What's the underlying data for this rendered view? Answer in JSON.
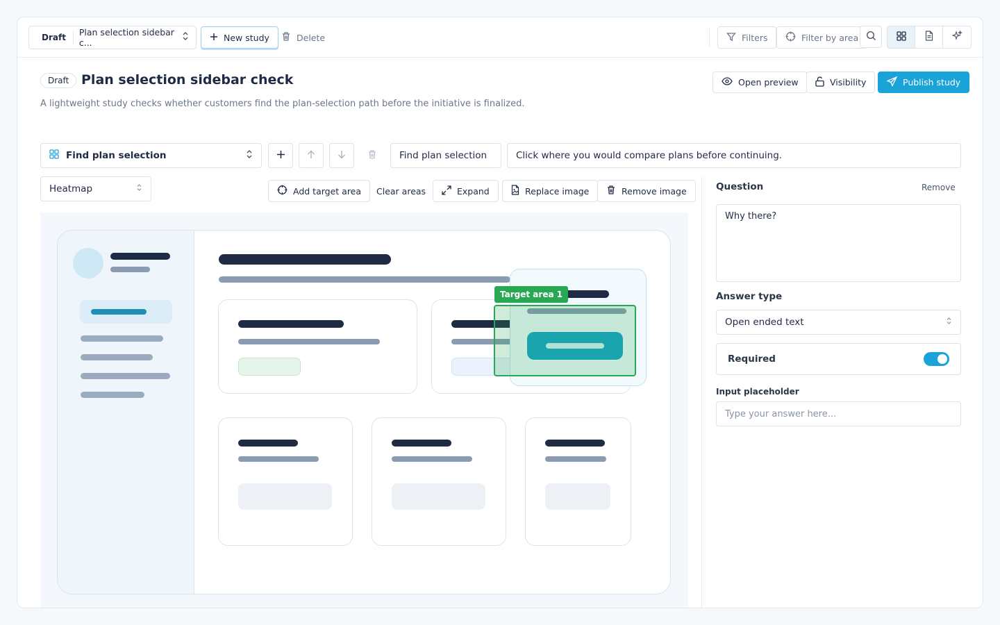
{
  "toolbar": {
    "draft_badge": "Draft",
    "study_select": "Plan selection sidebar c...",
    "new_study": "New study",
    "delete": "Delete",
    "filters": "Filters",
    "filter_by_area": "Filter by area"
  },
  "header": {
    "badge": "Draft",
    "title": "Plan selection sidebar check",
    "description": "A lightweight study checks whether customers find the plan-selection path before the initiative is finalized.",
    "open_preview": "Open preview",
    "visibility": "Visibility",
    "publish": "Publish study"
  },
  "task": {
    "select_label": "Find plan selection",
    "name_value": "Find plan selection",
    "prompt_value": "Click where you would compare plans before continuing."
  },
  "canvas_tools": {
    "mode": "Heatmap",
    "add_target": "Add target area",
    "clear_areas": "Clear areas",
    "expand": "Expand",
    "replace_image": "Replace image",
    "remove_image": "Remove image",
    "target_label": "Target area 1"
  },
  "panel": {
    "question_label": "Question",
    "remove": "Remove",
    "question_value": "Why there?",
    "answer_type_label": "Answer type",
    "answer_type_value": "Open ended text",
    "required_label": "Required",
    "required_on": true,
    "placeholder_label": "Input placeholder",
    "placeholder_value": "Type your answer here..."
  },
  "colors": {
    "accent": "#1aa3d9",
    "target_green": "#29a854",
    "dark_bar": "#1f2a44"
  }
}
